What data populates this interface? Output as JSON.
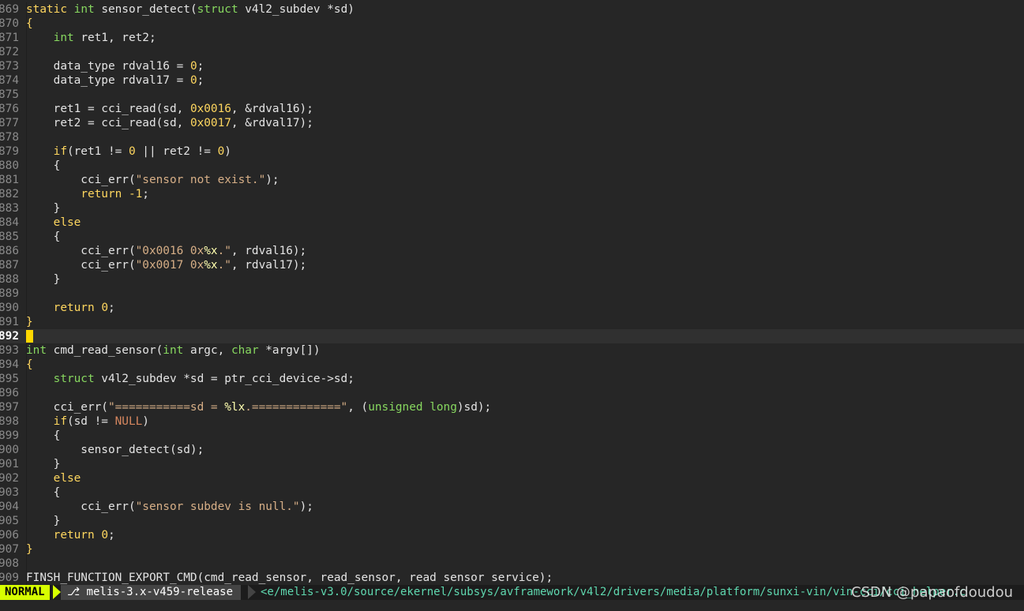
{
  "editor": {
    "mode": "vim",
    "current_line": "892",
    "lines": [
      {
        "num": "869",
        "tokens": [
          [
            "keyword",
            "static"
          ],
          [
            "plain",
            " "
          ],
          [
            "type",
            "int"
          ],
          [
            "plain",
            " sensor_detect("
          ],
          [
            "type",
            "struct"
          ],
          [
            "plain",
            " v4l2_subdev *sd)"
          ]
        ]
      },
      {
        "num": "870",
        "tokens": [
          [
            "brace",
            "{"
          ]
        ]
      },
      {
        "num": "871",
        "tokens": [
          [
            "plain",
            "    "
          ],
          [
            "type",
            "int"
          ],
          [
            "plain",
            " ret1, ret2;"
          ]
        ]
      },
      {
        "num": "872",
        "tokens": []
      },
      {
        "num": "873",
        "tokens": [
          [
            "plain",
            "    data_type rdval16 = "
          ],
          [
            "number",
            "0"
          ],
          [
            "plain",
            ";"
          ]
        ]
      },
      {
        "num": "874",
        "tokens": [
          [
            "plain",
            "    data_type rdval17 = "
          ],
          [
            "number",
            "0"
          ],
          [
            "plain",
            ";"
          ]
        ]
      },
      {
        "num": "875",
        "tokens": []
      },
      {
        "num": "876",
        "tokens": [
          [
            "plain",
            "    ret1 = cci_read(sd, "
          ],
          [
            "number",
            "0x0016"
          ],
          [
            "plain",
            ", &rdval16);"
          ]
        ]
      },
      {
        "num": "877",
        "tokens": [
          [
            "plain",
            "    ret2 = cci_read(sd, "
          ],
          [
            "number",
            "0x0017"
          ],
          [
            "plain",
            ", &rdval17);"
          ]
        ]
      },
      {
        "num": "878",
        "tokens": []
      },
      {
        "num": "879",
        "tokens": [
          [
            "plain",
            "    "
          ],
          [
            "keyword",
            "if"
          ],
          [
            "plain",
            "(ret1 != "
          ],
          [
            "number",
            "0"
          ],
          [
            "plain",
            " || ret2 != "
          ],
          [
            "number",
            "0"
          ],
          [
            "plain",
            ")"
          ]
        ]
      },
      {
        "num": "880",
        "tokens": [
          [
            "plain",
            "    {"
          ]
        ]
      },
      {
        "num": "881",
        "tokens": [
          [
            "plain",
            "        cci_err("
          ],
          [
            "string",
            "\"sensor not exist.\""
          ],
          [
            "plain",
            ");"
          ]
        ]
      },
      {
        "num": "882",
        "tokens": [
          [
            "plain",
            "        "
          ],
          [
            "keyword",
            "return"
          ],
          [
            "plain",
            " "
          ],
          [
            "number",
            "-1"
          ],
          [
            "plain",
            ";"
          ]
        ]
      },
      {
        "num": "883",
        "tokens": [
          [
            "plain",
            "    }"
          ]
        ]
      },
      {
        "num": "884",
        "tokens": [
          [
            "plain",
            "    "
          ],
          [
            "keyword",
            "else"
          ]
        ]
      },
      {
        "num": "885",
        "tokens": [
          [
            "plain",
            "    {"
          ]
        ]
      },
      {
        "num": "886",
        "tokens": [
          [
            "plain",
            "        cci_err("
          ],
          [
            "string",
            "\"0x0016 0x"
          ],
          [
            "fmt",
            "%x"
          ],
          [
            "string",
            ".\""
          ],
          [
            "plain",
            ", rdval16);"
          ]
        ]
      },
      {
        "num": "887",
        "tokens": [
          [
            "plain",
            "        cci_err("
          ],
          [
            "string",
            "\"0x0017 0x"
          ],
          [
            "fmt",
            "%x"
          ],
          [
            "string",
            ".\""
          ],
          [
            "plain",
            ", rdval17);"
          ]
        ]
      },
      {
        "num": "888",
        "tokens": [
          [
            "plain",
            "    }"
          ]
        ]
      },
      {
        "num": "889",
        "tokens": []
      },
      {
        "num": "890",
        "tokens": [
          [
            "plain",
            "    "
          ],
          [
            "keyword",
            "return"
          ],
          [
            "plain",
            " "
          ],
          [
            "number",
            "0"
          ],
          [
            "plain",
            ";"
          ]
        ]
      },
      {
        "num": "891",
        "tokens": [
          [
            "brace",
            "}"
          ]
        ]
      },
      {
        "num": "892",
        "tokens": [],
        "cursor": true
      },
      {
        "num": "893",
        "tokens": [
          [
            "type",
            "int"
          ],
          [
            "plain",
            " cmd_read_sensor("
          ],
          [
            "type",
            "int"
          ],
          [
            "plain",
            " argc, "
          ],
          [
            "type",
            "char"
          ],
          [
            "plain",
            " *argv[])"
          ]
        ]
      },
      {
        "num": "894",
        "tokens": [
          [
            "brace",
            "{"
          ]
        ]
      },
      {
        "num": "895",
        "tokens": [
          [
            "plain",
            "    "
          ],
          [
            "type",
            "struct"
          ],
          [
            "plain",
            " v4l2_subdev *sd = ptr_cci_device->sd;"
          ]
        ]
      },
      {
        "num": "896",
        "tokens": []
      },
      {
        "num": "897",
        "tokens": [
          [
            "plain",
            "    cci_err("
          ],
          [
            "string",
            "\"===========sd = "
          ],
          [
            "fmt",
            "%lx"
          ],
          [
            "string",
            ".=============\""
          ],
          [
            "plain",
            ", ("
          ],
          [
            "type",
            "unsigned"
          ],
          [
            "plain",
            " "
          ],
          [
            "type",
            "long"
          ],
          [
            "plain",
            ")sd);"
          ]
        ]
      },
      {
        "num": "898",
        "tokens": [
          [
            "plain",
            "    "
          ],
          [
            "keyword",
            "if"
          ],
          [
            "plain",
            "(sd != "
          ],
          [
            "const",
            "NULL"
          ],
          [
            "plain",
            ")"
          ]
        ]
      },
      {
        "num": "899",
        "tokens": [
          [
            "plain",
            "    {"
          ]
        ]
      },
      {
        "num": "900",
        "tokens": [
          [
            "plain",
            "        sensor_detect(sd);"
          ]
        ]
      },
      {
        "num": "901",
        "tokens": [
          [
            "plain",
            "    }"
          ]
        ]
      },
      {
        "num": "902",
        "tokens": [
          [
            "plain",
            "    "
          ],
          [
            "keyword",
            "else"
          ]
        ]
      },
      {
        "num": "903",
        "tokens": [
          [
            "plain",
            "    {"
          ]
        ]
      },
      {
        "num": "904",
        "tokens": [
          [
            "plain",
            "        cci_err("
          ],
          [
            "string",
            "\"sensor subdev is null.\""
          ],
          [
            "plain",
            ");"
          ]
        ]
      },
      {
        "num": "905",
        "tokens": [
          [
            "plain",
            "    }"
          ]
        ]
      },
      {
        "num": "906",
        "tokens": [
          [
            "plain",
            "    "
          ],
          [
            "keyword",
            "return"
          ],
          [
            "plain",
            " "
          ],
          [
            "number",
            "0"
          ],
          [
            "plain",
            ";"
          ]
        ]
      },
      {
        "num": "907",
        "tokens": [
          [
            "brace",
            "}"
          ]
        ]
      },
      {
        "num": "908",
        "tokens": []
      },
      {
        "num": "909",
        "tokens": [
          [
            "plain",
            "FINSH_FUNCTION_EXPORT_CMD(cmd_read_sensor, read_sensor, read sensor service);"
          ]
        ]
      }
    ]
  },
  "statusline": {
    "mode": "NORMAL",
    "branch": "⎇ melis-3.x-v459-release",
    "path": "<e/melis-v3.0/source/ekernel/subsys/avframework/v4l2/drivers/media/platform/sunxi-vin/vin-cci/cci_helper.c",
    "watermark": "CSDN @papaofdoudou"
  },
  "colors": {
    "background": "#262626",
    "keyword": "#ffd75f",
    "type": "#87d75f",
    "string": "#d7af87",
    "mode_bg": "#d7ff00",
    "path": "#5fd7af"
  }
}
